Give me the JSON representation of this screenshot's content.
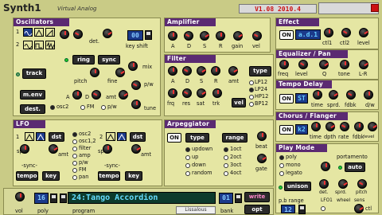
{
  "app": {
    "title": "Synth1",
    "subtitle": "Virtual Analog",
    "version": "V1.08 2010.4"
  },
  "osc": {
    "header": "Oscillators",
    "det": "det.",
    "key_shift_val": "00",
    "key_shift": "key shift",
    "ring": "ring",
    "sync": "sync",
    "mix": "mix",
    "track": "track",
    "pitch": "pitch",
    "fine": "fine",
    "menv": "m.env",
    "dest": "dest.",
    "A": "A",
    "D": "D",
    "amt": "amt",
    "osc2": "osc2",
    "FM": "FM",
    "pw": "p/w",
    "tune": "tune",
    "n1": "1",
    "n2": "2"
  },
  "amp": {
    "header": "Amplifier",
    "labels": [
      "A",
      "D",
      "S",
      "R",
      "gain",
      "vel"
    ]
  },
  "filter": {
    "header": "Filter",
    "labels": [
      "A",
      "D",
      "S",
      "R",
      "amt"
    ],
    "bottom": [
      "frq",
      "res",
      "sat",
      "trk"
    ],
    "type": "type",
    "vel": "vel",
    "types": [
      "LP12",
      "LP24",
      "HP12",
      "BP12"
    ]
  },
  "effect": {
    "header": "Effect",
    "on": "ON",
    "name": "a.d.1",
    "labels": [
      "ctl1",
      "ctl2",
      "level"
    ]
  },
  "eq": {
    "header": "Equalizer / Pan",
    "labels": [
      "freq",
      "level",
      "Q",
      "tone",
      "L-R"
    ]
  },
  "delay": {
    "header": "Tempo Delay",
    "on": "ON",
    "st": "ST",
    "labels": [
      "time",
      "sprd.",
      "fdbk",
      "d/w"
    ]
  },
  "chorus": {
    "header": "Chorus / Flanger",
    "on": "ON",
    "k2": "k2",
    "labels": [
      "time",
      "dpth",
      "rate",
      "fdbk",
      "level"
    ]
  },
  "lfo": {
    "header": "LFO",
    "n1": "1",
    "n2": "2",
    "dst": "dst",
    "spd": "spd",
    "amt": "amt",
    "sync": "-sync-",
    "tempo": "tempo",
    "key": "key",
    "dests": [
      "osc2",
      "osc1,2",
      "filter",
      "amp",
      "p/w",
      "FM",
      "pan"
    ]
  },
  "arp": {
    "header": "Arpeggiator",
    "on": "ON",
    "type": "type",
    "range": "range",
    "beat": "beat",
    "gate": "gate",
    "types": [
      "updown",
      "up",
      "down",
      "random"
    ],
    "ranges": [
      "1oct",
      "2oct",
      "3oct",
      "4oct"
    ]
  },
  "play": {
    "header": "Play Mode",
    "modes": [
      "poly",
      "mono",
      "legato"
    ],
    "portamento": "portamento",
    "auto": "auto",
    "unison": "unison",
    "det": "det.",
    "sprd": "sprd.",
    "pitch": "pitch",
    "pbrange": "p.b range",
    "pbval": "12",
    "lfo1": "LFO1",
    "wheel": "wheel",
    "sens": "sens",
    "ctl": "ctl"
  },
  "program": {
    "vol": "vol",
    "poly_val": "16",
    "poly": "poly",
    "name": "24:Tango Accordion",
    "program": "program",
    "bank_val": "01",
    "bank": "bank",
    "write": "write",
    "opt": "opt",
    "badge": "Lissalous"
  }
}
